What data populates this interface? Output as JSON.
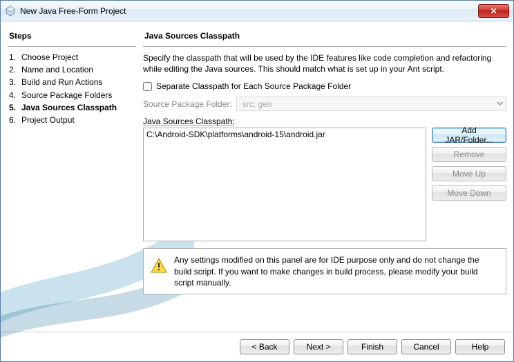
{
  "window": {
    "title": "New Java Free-Form Project",
    "close_label": "✕"
  },
  "sidebar": {
    "heading": "Steps",
    "items": [
      {
        "num": "1.",
        "label": "Choose Project"
      },
      {
        "num": "2.",
        "label": "Name and Location"
      },
      {
        "num": "3.",
        "label": "Build and Run Actions"
      },
      {
        "num": "4.",
        "label": "Source Package Folders"
      },
      {
        "num": "5.",
        "label": "Java Sources Classpath"
      },
      {
        "num": "6.",
        "label": "Project Output"
      }
    ],
    "current_index": 4
  },
  "main": {
    "heading": "Java Sources Classpath",
    "description": "Specify the classpath that will be used by the IDE features like code completion and refactoring while editing the Java sources. This should match what is set up in your Ant script.",
    "separate_checkbox_label": "Separate Classpath for Each Source Package Folder",
    "separate_checked": false,
    "source_folder_label": "Source Package Folder:",
    "source_folder_value": "src; gen",
    "classpath_label": "Java Sources Classpath:",
    "classpath_items": [
      "C:\\Android-SDK\\platforms\\android-15\\android.jar"
    ],
    "buttons": {
      "add": "Add JAR/Folder...",
      "remove": "Remove",
      "move_up": "Move Up",
      "move_down": "Move Down"
    },
    "warning": "Any settings modified on this panel are for IDE purpose only and do not change the build script. If you want to make changes in build process, please modify your build script manually."
  },
  "footer": {
    "back": "< Back",
    "next": "Next >",
    "finish": "Finish",
    "cancel": "Cancel",
    "help": "Help"
  }
}
